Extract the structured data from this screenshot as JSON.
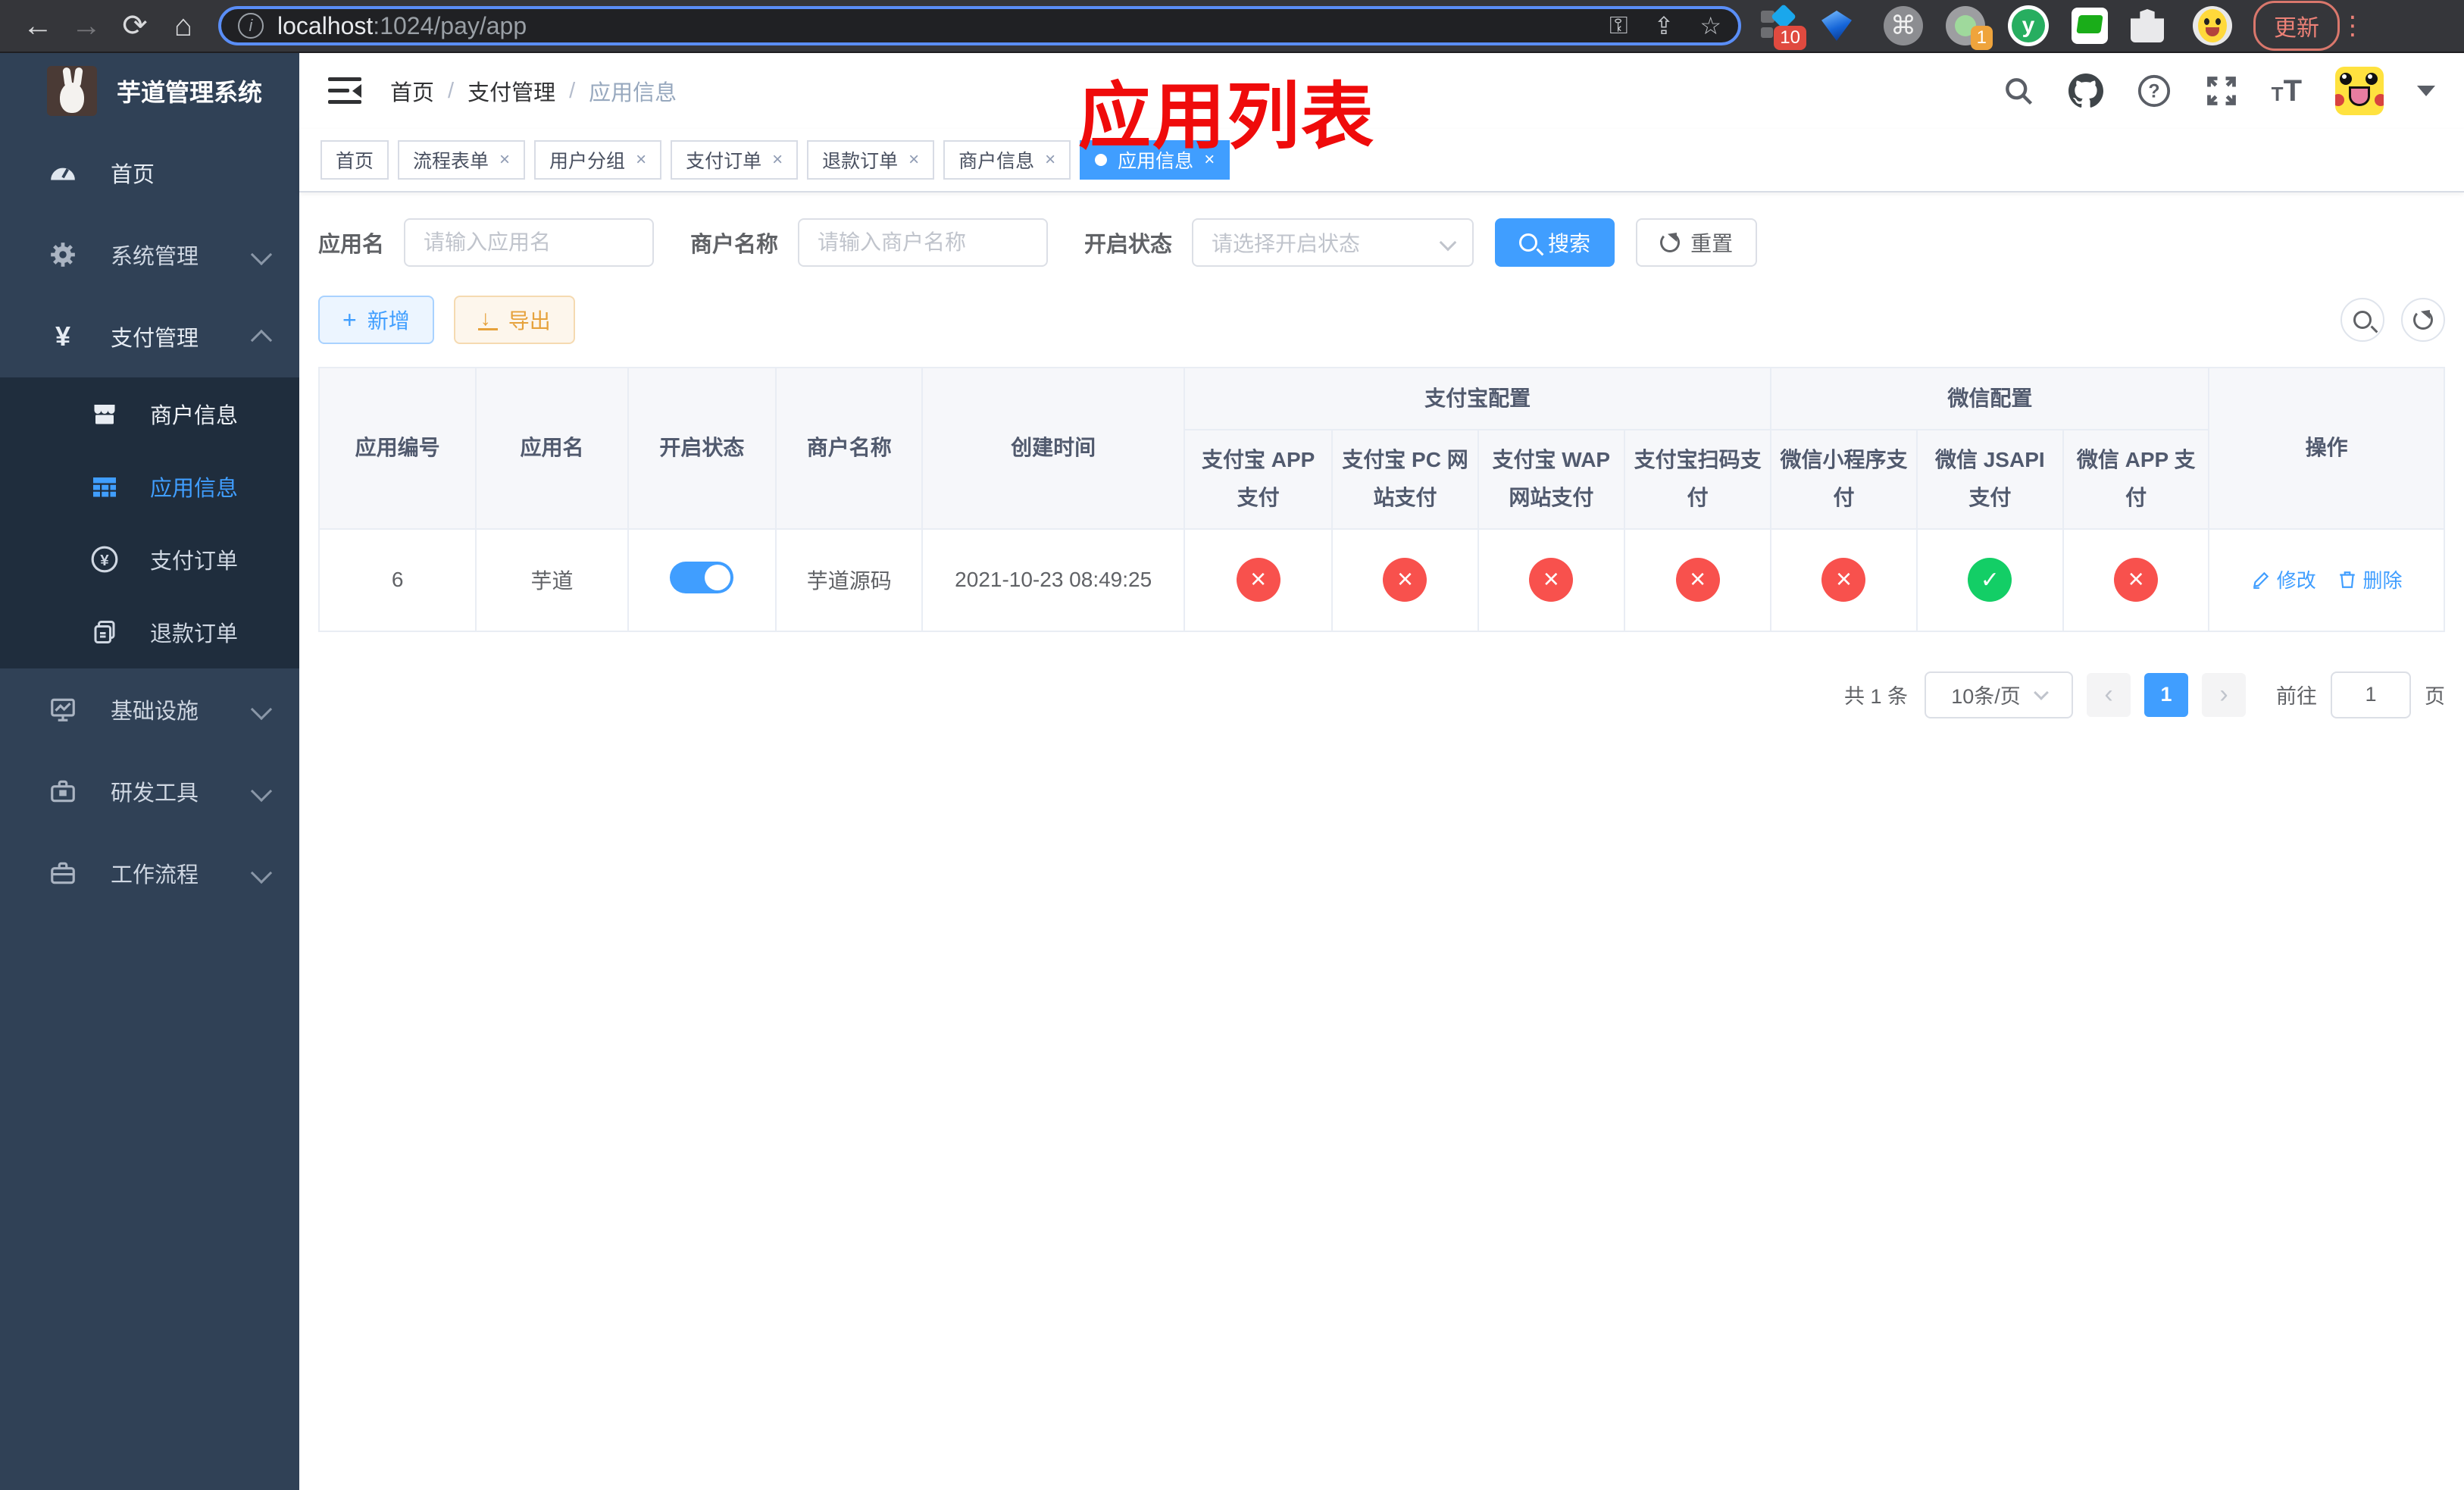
{
  "browser": {
    "url_host": "localhost",
    "url_rest": ":1024/pay/app",
    "update_button": "更新",
    "ext_badge_count": "10",
    "profile_badge_count": "1"
  },
  "sidebar": {
    "title": "芋道管理系统",
    "items": [
      {
        "label": "首页"
      },
      {
        "label": "系统管理"
      },
      {
        "label": "支付管理"
      },
      {
        "label": "商户信息"
      },
      {
        "label": "应用信息"
      },
      {
        "label": "支付订单"
      },
      {
        "label": "退款订单"
      },
      {
        "label": "基础设施"
      },
      {
        "label": "研发工具"
      },
      {
        "label": "工作流程"
      }
    ]
  },
  "navbar": {
    "breadcrumb": [
      "首页",
      "支付管理",
      "应用信息"
    ],
    "separator": "/"
  },
  "overlay_title": "应用列表",
  "tabs": [
    {
      "label": "首页"
    },
    {
      "label": "流程表单"
    },
    {
      "label": "用户分组"
    },
    {
      "label": "支付订单"
    },
    {
      "label": "退款订单"
    },
    {
      "label": "商户信息"
    },
    {
      "label": "应用信息"
    }
  ],
  "tab_close_glyph": "×",
  "filter": {
    "app_name_label": "应用名",
    "app_name_placeholder": "请输入应用名",
    "merchant_label": "商户名称",
    "merchant_placeholder": "请输入商户名称",
    "status_label": "开启状态",
    "status_placeholder": "请选择开启状态",
    "search_button": "搜索",
    "reset_button": "重置"
  },
  "toolbar": {
    "add_button": "新增",
    "export_button": "导出"
  },
  "table": {
    "columns": [
      "应用编号",
      "应用名",
      "开启状态",
      "商户名称",
      "创建时间"
    ],
    "group_alipay": "支付宝配置",
    "group_wechat": "微信配置",
    "alipay_columns": [
      "支付宝 APP 支付",
      "支付宝 PC 网站支付",
      "支付宝 WAP 网站支付",
      "支付宝扫码支付"
    ],
    "wechat_columns": [
      "微信小程序支付",
      "微信 JSAPI 支付",
      "微信 APP 支付"
    ],
    "action_column": "操作",
    "row": {
      "id": "6",
      "name": "芋道",
      "enabled": true,
      "merchant": "芋道源码",
      "created_at": "2021-10-23 08:49:25",
      "alipay_app": false,
      "alipay_pc": false,
      "alipay_wap": false,
      "alipay_qr": false,
      "wechat_lite": false,
      "wechat_jsapi": true,
      "wechat_app": false,
      "edit_action": "修改",
      "delete_action": "删除"
    }
  },
  "pagination": {
    "total_text": "共 1 条",
    "page_size": "10条/页",
    "current_page": "1",
    "prev_glyph": "‹",
    "next_glyph": "›",
    "goto_prefix": "前往",
    "goto_value": "1",
    "goto_suffix": "页"
  },
  "colors": {
    "accent": "#409eff",
    "status_off": "#f8514d",
    "status_on": "#13ce66",
    "sidebar_bg": "#304156",
    "submenu_bg": "#1f2d3d",
    "annotation_red": "#ef0b0b"
  }
}
